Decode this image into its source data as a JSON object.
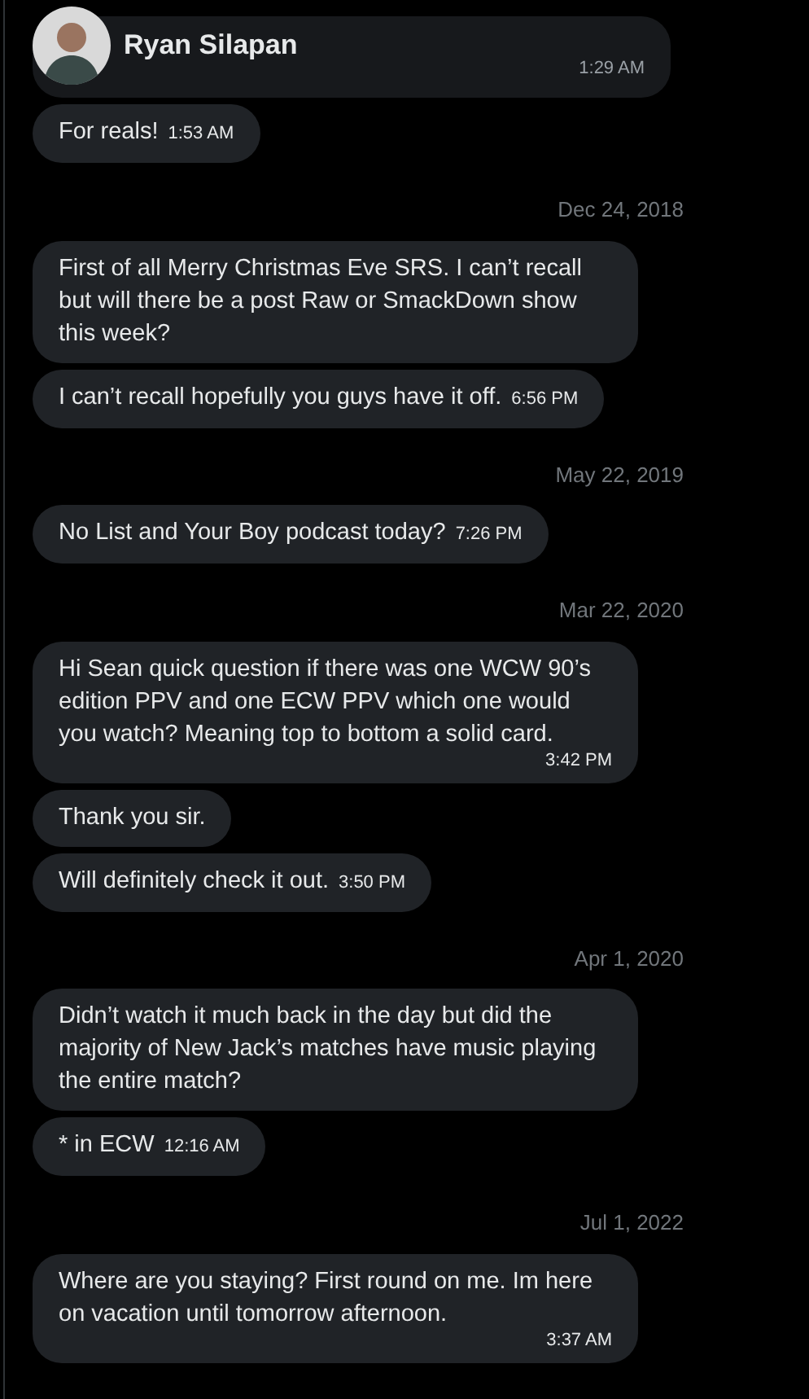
{
  "header": {
    "name": "Ryan Silapan"
  },
  "groups": [
    {
      "messages": [
        {
          "time": "1:29 AM",
          "kind": "covered"
        },
        {
          "text": "For reals!",
          "time": "1:53 AM",
          "kind": "inline"
        }
      ]
    },
    {
      "date": "Dec 24, 2018",
      "messages": [
        {
          "text": "First of all Merry Christmas Eve SRS. I can’t recall but will there be a post Raw or SmackDown show this week?",
          "kind": "inline"
        },
        {
          "text": "I can’t recall hopefully you guys have it off.",
          "time": "6:56 PM",
          "kind": "inline"
        }
      ]
    },
    {
      "date": "May 22, 2019",
      "messages": [
        {
          "text": "No List and Your Boy podcast today?",
          "time": "7:26 PM",
          "kind": "inline"
        }
      ]
    },
    {
      "date": "Mar 22, 2020",
      "messages": [
        {
          "text": "Hi Sean quick question if there was one WCW 90’s edition PPV and one ECW PPV which one would you watch? Meaning top to bottom a solid card.",
          "time": "3:42 PM",
          "kind": "below"
        },
        {
          "text": "Thank you sir.",
          "kind": "inline"
        },
        {
          "text": "Will definitely check it out.",
          "time": "3:50 PM",
          "kind": "inline"
        }
      ]
    },
    {
      "date": "Apr 1, 2020",
      "messages": [
        {
          "text": "Didn’t watch it much back in the day but did the majority of New Jack’s matches have music playing the entire match?",
          "kind": "inline"
        },
        {
          "text": "* in ECW",
          "time": "12:16 AM",
          "kind": "inline"
        }
      ]
    },
    {
      "date": "Jul 1, 2022",
      "messages": [
        {
          "text": "Where are you staying? First round on me. Im here on vacation until tomorrow afternoon.",
          "time": "3:37 AM",
          "kind": "below"
        }
      ]
    }
  ]
}
